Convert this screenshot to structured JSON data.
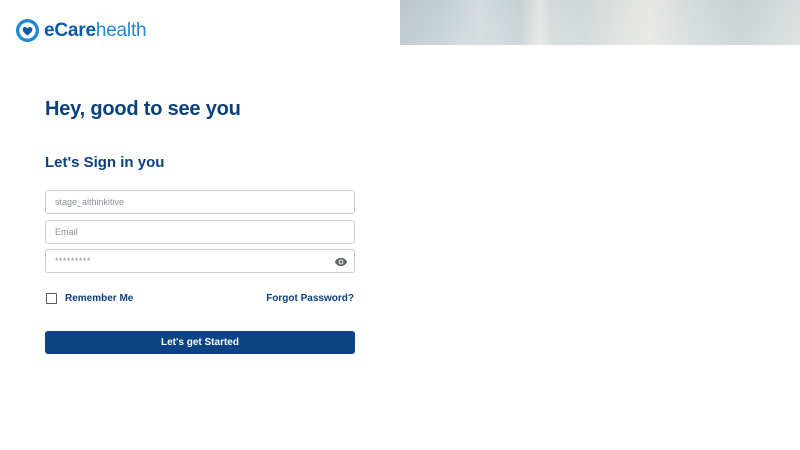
{
  "brand": {
    "name_part1": "eCare",
    "name_part2": "health",
    "primary_color": "#0b3f7d",
    "accent_color": "#1e88d6"
  },
  "greeting": "Hey, good to see you",
  "subheading": "Let's Sign in you",
  "form": {
    "username": {
      "value": "",
      "placeholder": "stage_aithinkitive"
    },
    "email": {
      "value": "",
      "placeholder": "Email"
    },
    "password": {
      "value": "",
      "placeholder": "*********",
      "icon": "eye-icon"
    },
    "remember_label": "Remember Me",
    "remember_checked": false,
    "forgot_label": "Forgot Password?",
    "submit_label": "Let's get Started",
    "submit_color": "#0b4384"
  }
}
